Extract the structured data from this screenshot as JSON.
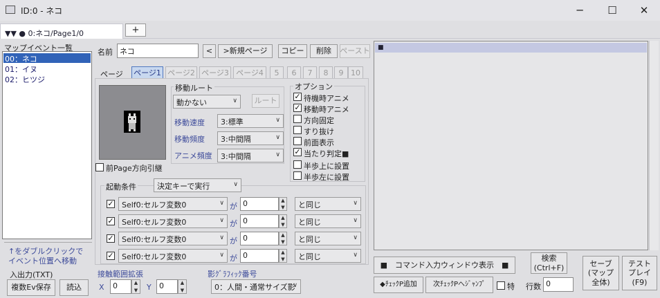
{
  "window": {
    "title": "ID:0 - ネコ",
    "minimize_glyph": "─",
    "maximize_glyph": "☐",
    "close_glyph": "✕"
  },
  "tabs": {
    "active_label": "▼▼ ● 0:ネコ/Page1/0",
    "add_label": "+"
  },
  "sidebar": {
    "header": "マップイベント一覧",
    "items": [
      {
        "label": "00：ネコ"
      },
      {
        "label": "01：イヌ"
      },
      {
        "label": "02：ヒツジ"
      }
    ],
    "hint_line1": "↑をダブルクリックで",
    "hint_line2": "イベント位置へ移動",
    "io_label": "入出力(TXT)",
    "save_multi_label": "複数Ev保存",
    "load_label": "読込"
  },
  "event": {
    "name_label": "名前",
    "name_value": "ネコ",
    "prev_label": "<",
    "new_page_label": ">新規ページ",
    "copy_label": "コピー",
    "delete_label": "削除",
    "paste_label": "ペースト"
  },
  "pages": {
    "label": "ページ",
    "tabs": [
      "ページ1",
      "ページ2",
      "ページ3",
      "ページ4",
      "5",
      "6",
      "7",
      "8",
      "9",
      "10"
    ]
  },
  "graphic": {
    "inherit_label": "前Page方向引継"
  },
  "movement": {
    "route_group": "移動ルート",
    "route_value": "動かない",
    "route_button": "ルート",
    "speed_label": "移動速度",
    "speed_value": "3:標準",
    "freq_label": "移動頻度",
    "freq_value": "3:中間隔",
    "anim_label": "アニメ頻度",
    "anim_value": "3:中間隔"
  },
  "options": {
    "title": "オプション",
    "items": [
      {
        "label": "待機時アニメ",
        "checked": true
      },
      {
        "label": "移動時アニメ",
        "checked": true
      },
      {
        "label": "方向固定",
        "checked": false
      },
      {
        "label": "すり抜け",
        "checked": false
      },
      {
        "label": "前面表示",
        "checked": false
      },
      {
        "label": "当たり判定■",
        "checked": true
      },
      {
        "label": "半歩上に設置",
        "checked": false
      },
      {
        "label": "半歩左に設置",
        "checked": false
      }
    ]
  },
  "trigger": {
    "label": "起動条件",
    "value": "決定キーで実行",
    "conditions": [
      {
        "var": "Self0:セルフ変数0",
        "ga": "が",
        "value": "0",
        "op": "と同じ"
      },
      {
        "var": "Self0:セルフ変数0",
        "ga": "が",
        "value": "0",
        "op": "と同じ"
      },
      {
        "var": "Self0:セルフ変数0",
        "ga": "が",
        "value": "0",
        "op": "と同じ"
      },
      {
        "var": "Self0:セルフ変数0",
        "ga": "が",
        "value": "0",
        "op": "と同じ"
      }
    ]
  },
  "contact": {
    "label": "接触範囲拡張",
    "x_label": "X",
    "x_value": "0",
    "y_label": "Y",
    "y_value": "0"
  },
  "shadow": {
    "label": "影ｸﾞﾗﾌｨｯｸ番号",
    "value": "0：人間・通常サイズ影"
  },
  "commands": {
    "first_line": "■",
    "window_button": "■　コマンド入力ウィンドウ表示　■",
    "search_button": "検索\n(Ctrl+F)",
    "save_button": "セーブ\n(マップ\n全体)",
    "test_button": "テスト\nプレイ\n(F9)",
    "add_checkpoint": "◆ﾁｪｯｸP追加",
    "next_checkpoint": "次ﾁｪｯｸPへｼﾞｬﾝﾌﾟ",
    "special_label": "特",
    "line_count_label": "行数",
    "line_count_value": "0"
  }
}
